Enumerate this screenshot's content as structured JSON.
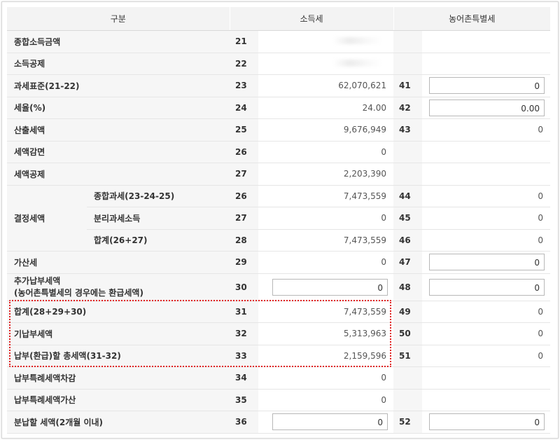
{
  "header": {
    "col1": "구분",
    "col2": "소득세",
    "col3": "농어촌특별세"
  },
  "rows": {
    "r21": {
      "label": "종합소득금액",
      "no": "21"
    },
    "r22": {
      "label": "소득공제",
      "no": "22"
    },
    "r23": {
      "label": "과세표준(21-22)",
      "no": "23",
      "value": "62,070,621",
      "no2": "41",
      "input2": "0"
    },
    "r24": {
      "label": "세율(%)",
      "no": "24",
      "value": "24.00",
      "no2": "42",
      "input2": "0.00"
    },
    "r25": {
      "label": "산출세액",
      "no": "25",
      "value": "9,676,949",
      "no2": "43",
      "value2": "0"
    },
    "r26a": {
      "label": "세액감면",
      "no": "26",
      "value": "0"
    },
    "r27a": {
      "label": "세액공제",
      "no": "27",
      "value": "2,203,390"
    },
    "decision": {
      "label": "결정세액"
    },
    "r26b": {
      "label": "종합과세(23-24-25)",
      "no": "26",
      "value": "7,473,559",
      "no2": "44",
      "value2": "0"
    },
    "r27b": {
      "label": "분리과세소득",
      "no": "27",
      "value": "0",
      "no2": "45",
      "value2": "0"
    },
    "r28": {
      "label": "합계(26+27)",
      "no": "28",
      "value": "7,473,559",
      "no2": "46",
      "value2": "0"
    },
    "r29": {
      "label": "가산세",
      "no": "29",
      "value": "0",
      "no2": "47",
      "input2": "0"
    },
    "r30": {
      "label1": "추가납부세액",
      "label2": "(농어촌특별세의 경우에는 환급세액)",
      "no": "30",
      "input": "0",
      "no2": "48",
      "input2": "0"
    },
    "r31": {
      "label": "합계(28+29+30)",
      "no": "31",
      "value": "7,473,559",
      "no2": "49",
      "value2": "0"
    },
    "r32": {
      "label": "기납부세액",
      "no": "32",
      "value": "5,313,963",
      "no2": "50",
      "value2": "0"
    },
    "r33": {
      "label": "납부(환급)할 총세액(31-32)",
      "no": "33",
      "value": "2,159,596",
      "no2": "51",
      "value2": "0"
    },
    "r34": {
      "label": "납부특례세액차감",
      "no": "34",
      "value": "0"
    },
    "r35": {
      "label": "납부특례세액가산",
      "no": "35",
      "value": "0"
    },
    "r36": {
      "label": "분납할 세액(2개월 이내)",
      "no": "36",
      "input": "0",
      "no2": "52",
      "input2": "0"
    }
  },
  "colors": {
    "highlight_border": "#e02020",
    "label_bg": "#f6f6f6",
    "header_bg": "#f3f3f3"
  }
}
